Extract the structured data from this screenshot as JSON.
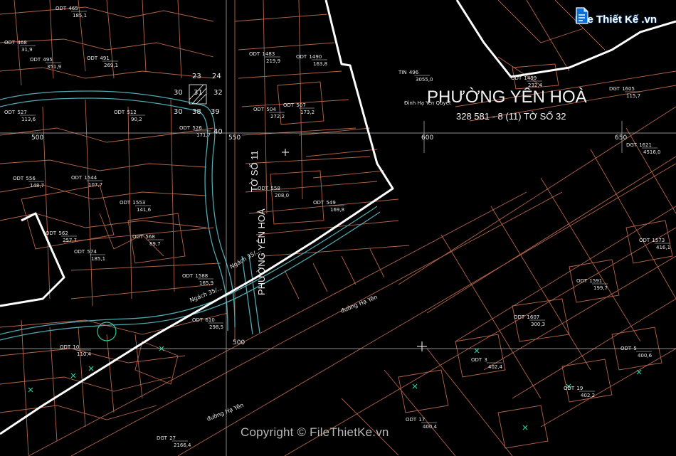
{
  "map": {
    "ward_label": "PHƯỜNG YÊN HOÀ",
    "sheet_label": "328 581 - 8 (11) TỜ SỐ 32",
    "temple_label": "Đình Hạ Yên Quyết",
    "vertical_label_1": "PHƯỜNG YÊN HOÀ",
    "vertical_label_2": "TỜ SỐ 11",
    "street_labels": [
      "đường Hạ Yên",
      "đường Hạ Yên"
    ],
    "alley_labels": [
      "Ngách 35/...",
      "Ngách 35/..."
    ],
    "grid_numbers": [
      "500",
      "550",
      "600",
      "650",
      "500"
    ],
    "colors": {
      "background": "#000000",
      "parcel": "#b5654a",
      "boundary": "#ffffff",
      "canal": "#4fa8b0",
      "grid": "#bdbdbd",
      "text": "#e8e8e8",
      "marker": "#2ecc9a",
      "brand": "#0a6fd6"
    },
    "parcels": [
      {
        "code": "ODT",
        "num": "465",
        "area": "185,1"
      },
      {
        "code": "ODT",
        "num": "468",
        "area": "31,9"
      },
      {
        "code": "ODT",
        "num": "495",
        "area": "351,9"
      },
      {
        "code": "ODT",
        "num": "491",
        "area": "269,1"
      },
      {
        "code": "ODT",
        "num": "527",
        "area": "113,6"
      },
      {
        "code": "ODT",
        "num": "512",
        "area": "90,2"
      },
      {
        "code": "ODT",
        "num": "526",
        "area": "171,7"
      },
      {
        "code": "ODT",
        "num": "556",
        "area": "148,7"
      },
      {
        "code": "ODT",
        "num": "1544",
        "area": "107,7"
      },
      {
        "code": "ODT",
        "num": "562",
        "area": "257,7"
      },
      {
        "code": "ODT",
        "num": "1553",
        "area": "141,6"
      },
      {
        "code": "ODT",
        "num": "568",
        "area": "89,7"
      },
      {
        "code": "ODT",
        "num": "574",
        "area": "185,1"
      },
      {
        "code": "ODT",
        "num": "1588",
        "area": "165,9"
      },
      {
        "code": "ODT",
        "num": "1483",
        "area": "219,9"
      },
      {
        "code": "ODT",
        "num": "1490",
        "area": "163,8"
      },
      {
        "code": "ODT",
        "num": "504",
        "area": "272,2"
      },
      {
        "code": "ODT",
        "num": "507",
        "area": "173,2"
      },
      {
        "code": "ODT",
        "num": "558",
        "area": "208,0"
      },
      {
        "code": "ODT",
        "num": "549",
        "area": "169,8"
      },
      {
        "code": "ODT",
        "num": "610",
        "area": "298,5"
      },
      {
        "code": "ODT",
        "num": "10",
        "area": "110,4"
      },
      {
        "code": "ODT",
        "num": "3",
        "area": "402,4"
      },
      {
        "code": "ODT",
        "num": "19",
        "area": "402,2"
      },
      {
        "code": "ODT",
        "num": "1607",
        "area": "300,3"
      },
      {
        "code": "ODT",
        "num": "1591",
        "area": "199,7"
      },
      {
        "code": "ODT",
        "num": "1573",
        "area": "416,1"
      },
      {
        "code": "ODT",
        "num": "5",
        "area": "400,6"
      },
      {
        "code": "ODT",
        "num": "17",
        "area": "400,4"
      },
      {
        "code": "DGT",
        "num": "27",
        "area": "2166,4"
      },
      {
        "code": "DGT",
        "num": "1621",
        "area": "4516,0"
      },
      {
        "code": "DGT",
        "num": "1605",
        "area": "115,7"
      },
      {
        "code": "ODT",
        "num": "1499",
        "area": "232,4"
      },
      {
        "code": "TIN",
        "num": "496",
        "area": "3055,0"
      }
    ],
    "small_grid_numbers": [
      "23",
      "24",
      "30",
      "31",
      "32",
      "30",
      "38",
      "39",
      "40"
    ]
  },
  "watermark": {
    "logo_text": "File Thiết Kế .vn",
    "copyright": "Copyright © FileThietKe.vn"
  }
}
